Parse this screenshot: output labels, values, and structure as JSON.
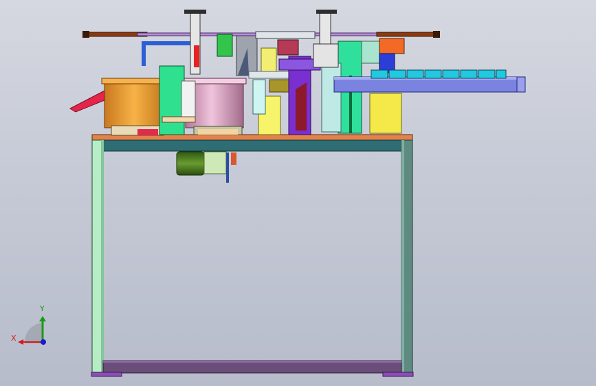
{
  "view": {
    "background_top": "#d5d8e0",
    "background_bottom": "#b7bccb"
  },
  "triad": {
    "x_label": "X",
    "y_label": "Y",
    "x_color": "#d11a1a",
    "y_color": "#1a9a1a",
    "z_color": "#1a1ad1"
  }
}
